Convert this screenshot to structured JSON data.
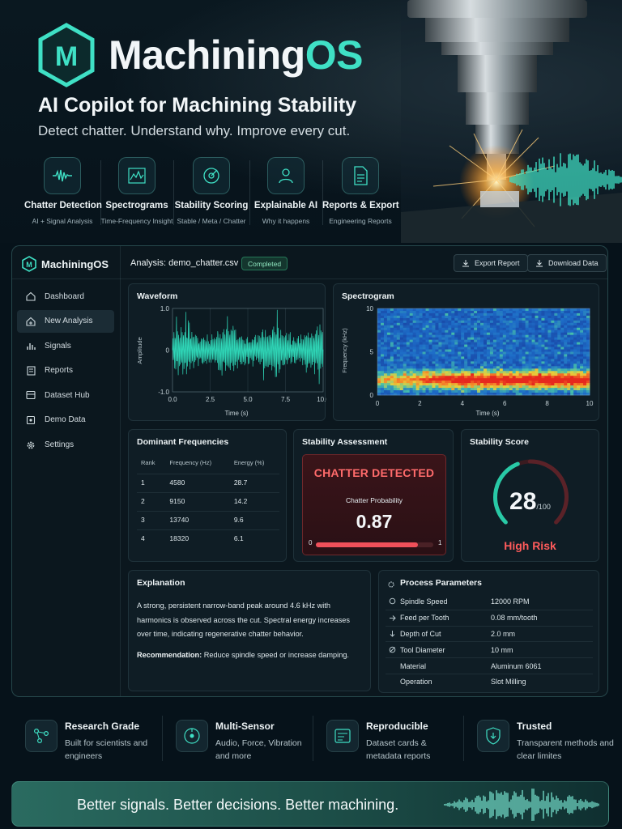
{
  "hero": {
    "logo_letter": "M",
    "brand_main": "Machining",
    "brand_accent": "OS",
    "tagline": "AI Copilot for Machining Stability",
    "subtagline": "Detect chatter. Understand why. Improve every cut.",
    "features": [
      {
        "title": "Chatter Detection",
        "sub": "AI + Signal Analysis",
        "icon": "waveform-icon"
      },
      {
        "title": "Spectrograms",
        "sub": "Time-Frequency Insight",
        "icon": "spectrum-chart-icon"
      },
      {
        "title": "Stability Scoring",
        "sub": "Stable / Meta / Chatter",
        "icon": "gauge-target-icon"
      },
      {
        "title": "Explainable AI",
        "sub": "Why it happens",
        "icon": "person-icon"
      },
      {
        "title": "Reports & Export",
        "sub": "Engineering Reports",
        "icon": "document-icon"
      }
    ]
  },
  "app": {
    "brand": "MachiningOS",
    "analysis_title": "Analysis: demo_chatter.csv",
    "status_badge": "Completed",
    "export_label": "Export Report",
    "download_label": "Download Data",
    "nav": [
      {
        "label": "Dashboard",
        "icon": "home-icon",
        "active": false
      },
      {
        "label": "New Analysis",
        "icon": "home-plus-icon",
        "active": true
      },
      {
        "label": "Signals",
        "icon": "signal-bars-icon",
        "active": false
      },
      {
        "label": "Reports",
        "icon": "report-icon",
        "active": false
      },
      {
        "label": "Dataset Hub",
        "icon": "database-icon",
        "active": false
      },
      {
        "label": "Demo Data",
        "icon": "flask-icon",
        "active": false
      },
      {
        "label": "Settings",
        "icon": "gear-icon",
        "active": false
      }
    ],
    "waveform": {
      "title": "Waveform",
      "ylabel": "Amplitude",
      "xlabel": "Time (s)"
    },
    "spectrogram": {
      "title": "Spectrogram",
      "ylabel": "Frequency (kHz)",
      "xlabel": "Time (s)"
    },
    "frequencies": {
      "title": "Dominant Frequencies",
      "headers": [
        "Rank",
        "Frequency (Hz)",
        "Energy (%)"
      ],
      "rows": [
        [
          "1",
          "4580",
          "28.7"
        ],
        [
          "2",
          "9150",
          "14.2"
        ],
        [
          "3",
          "13740",
          "9.6"
        ],
        [
          "4",
          "18320",
          "6.1"
        ]
      ]
    },
    "stability": {
      "title": "Stability Assessment",
      "status": "CHATTER DETECTED",
      "prob_label": "Chatter Probability",
      "prob_value": "0.87",
      "prob_fraction": 0.87,
      "min": "0",
      "max": "1"
    },
    "score": {
      "title": "Stability Score",
      "value": "28",
      "denominator": "/100",
      "fraction": 0.28,
      "risk": "High Risk"
    },
    "explanation": {
      "title": "Explanation",
      "text": "A strong, persistent narrow-band peak around 4.6 kHz with harmonics is observed across the cut. Spectral energy increases over time, indicating regenerative chatter behavior.",
      "rec_label": "Recommendation:",
      "rec_text": " Reduce spindle speed or increase damping."
    },
    "process": {
      "title": "Process Parameters",
      "rows": [
        {
          "label": "Spindle Speed",
          "value": "12000 RPM",
          "icon": "spindle-icon"
        },
        {
          "label": "Feed per Tooth",
          "value": "0.08 mm/tooth",
          "icon": "feed-arrow-icon"
        },
        {
          "label": "Depth of Cut",
          "value": "2.0 mm",
          "icon": "depth-icon"
        },
        {
          "label": "Tool Diameter",
          "value": "10 mm",
          "icon": "diameter-icon"
        },
        {
          "label": "Material",
          "value": "Aluminum 6061",
          "icon": ""
        },
        {
          "label": "Operation",
          "value": "Slot Milling",
          "icon": ""
        }
      ]
    }
  },
  "bottom_features": [
    {
      "title": "Research Grade",
      "sub": "Built for scientists and engineers",
      "icon": "molecule-icon"
    },
    {
      "title": "Multi-Sensor",
      "sub": "Audio, Force, Vibration and more",
      "icon": "sensor-icon"
    },
    {
      "title": "Reproducible",
      "sub": "Dataset cards & metadata reports",
      "icon": "dataset-card-icon"
    },
    {
      "title": "Trusted",
      "sub": "Transparent methods and clear limites",
      "icon": "shield-icon"
    }
  ],
  "banner": {
    "text": "Better signals. Better decisions. Better machining."
  },
  "chart_data": [
    {
      "type": "line",
      "title": "Waveform",
      "xlabel": "Time (s)",
      "ylabel": "Amplitude",
      "xlim": [
        0,
        10
      ],
      "ylim": [
        -1,
        1
      ],
      "xticks": [
        "0.0",
        "2.5",
        "5.0",
        "7.5",
        "10.0"
      ],
      "yticks": [
        "1.0",
        "0",
        "-1.0"
      ],
      "grid": true
    },
    {
      "type": "heatmap",
      "title": "Spectrogram",
      "xlabel": "Time (s)",
      "ylabel": "Frequency (kHz)",
      "xlim": [
        0,
        10
      ],
      "ylim": [
        0,
        10
      ],
      "xticks": [
        "0",
        "2",
        "4",
        "6",
        "8",
        "10"
      ],
      "yticks": [
        "10",
        "5",
        "0"
      ],
      "dominant_band_khz": 4.6
    }
  ]
}
